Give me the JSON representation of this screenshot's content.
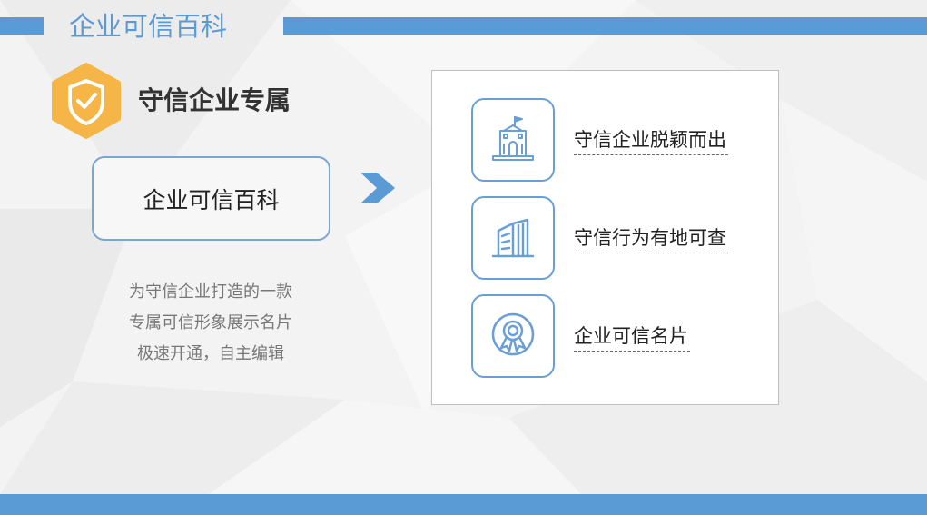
{
  "header": {
    "title": "企业可信百科"
  },
  "intro": {
    "heading": "守信企业专属",
    "product_name": "企业可信百科",
    "description_lines": [
      "为守信企业打造的一款",
      "专属可信形象展示名片",
      "极速开通，自主编辑"
    ]
  },
  "features": [
    {
      "icon": "building-flag-icon",
      "label": "守信企业脱颖而出"
    },
    {
      "icon": "office-building-icon",
      "label": "守信行为有地可查"
    },
    {
      "icon": "award-badge-icon",
      "label": "企业可信名片"
    }
  ],
  "colors": {
    "accent": "#5b9bd5",
    "shield": "#f5b547",
    "icon_stroke": "#6a9fd6",
    "text": "#333333",
    "muted": "#777777"
  }
}
